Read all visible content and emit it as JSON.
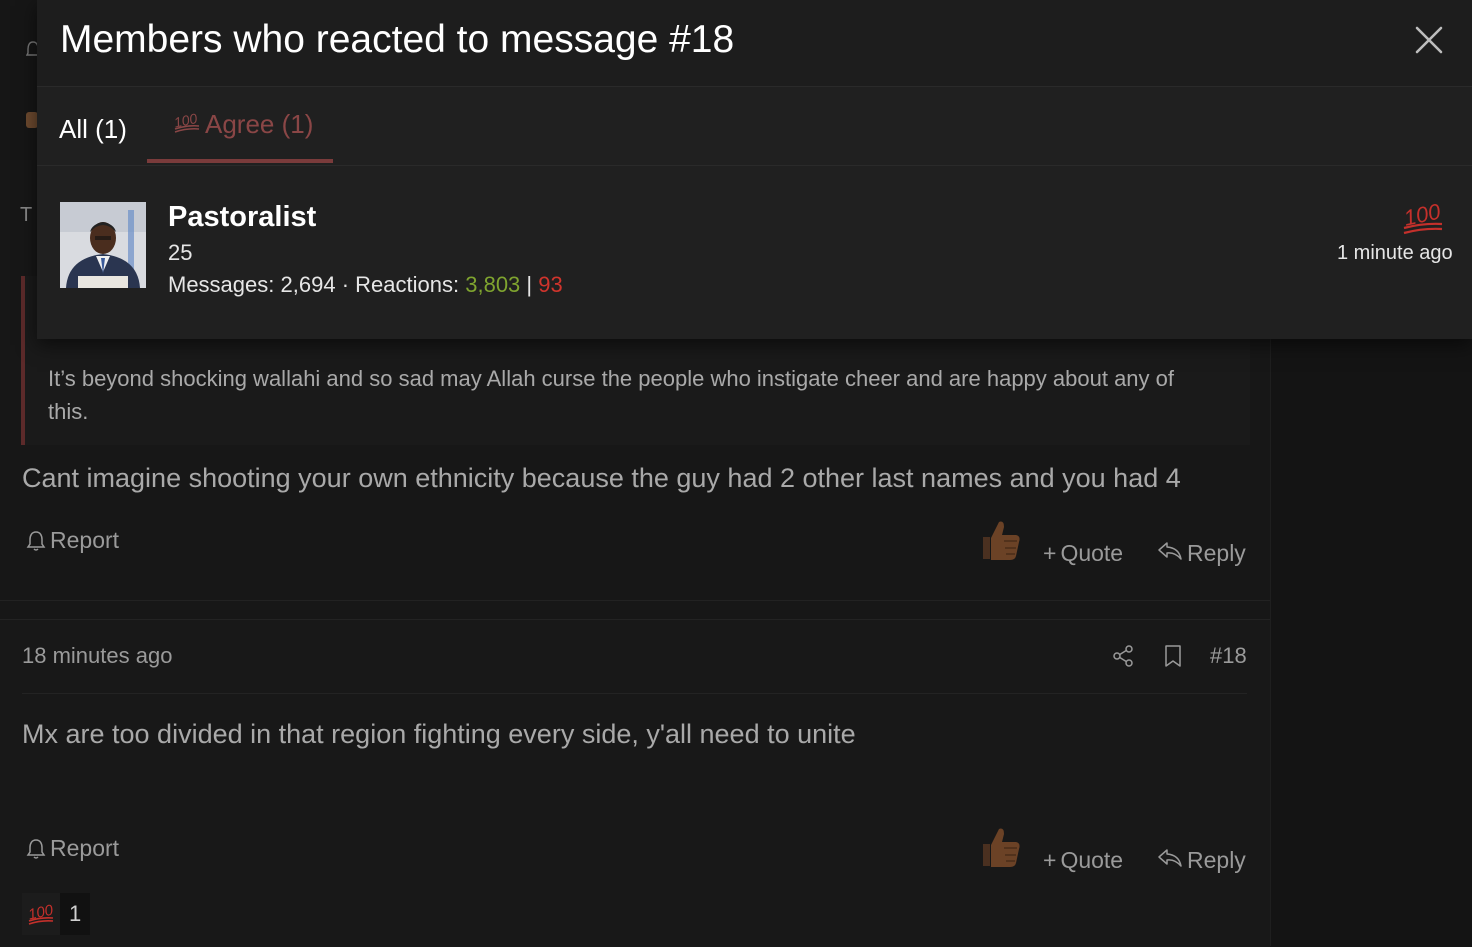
{
  "modal": {
    "title": "Members who reacted to message #18",
    "close_label": "×",
    "tabs": [
      {
        "label": "All (1)"
      },
      {
        "label": "Agree (1)",
        "icon": "hundred-points-icon"
      }
    ],
    "members": [
      {
        "name": "Pastoralist",
        "subtitle": "25",
        "messages_label": "Messages:",
        "messages": "2,694",
        "separator": "·",
        "reactions_label": "Reactions:",
        "reactions_positive": "3,803",
        "reactions_divider": "|",
        "reactions_negative": "93",
        "reaction_icon": "hundred-points-icon",
        "reaction_time": "1 minute ago"
      }
    ]
  },
  "post1": {
    "quote_text": "It’s beyond shocking wallahi and so sad may Allah curse the people who instigate cheer and are happy about any of this.",
    "body": "Cant imagine shooting your own ethnicity because the guy had 2 other last names and you had 4",
    "report_label": "Report",
    "quote_label": "Quote",
    "reply_label": "Reply"
  },
  "post2": {
    "time_ago": "18 minutes ago",
    "post_number": "#18",
    "body": "Mx are too divided in that region fighting every side, y'all need to unite",
    "report_label": "Report",
    "quote_label": "Quote",
    "reply_label": "Reply",
    "reaction_summary": {
      "icon": "hundred-points-icon",
      "count": "1"
    }
  },
  "colors": {
    "positive": "#7fa42f",
    "negative": "#d0342c",
    "agree_tab": "#8a4646"
  }
}
